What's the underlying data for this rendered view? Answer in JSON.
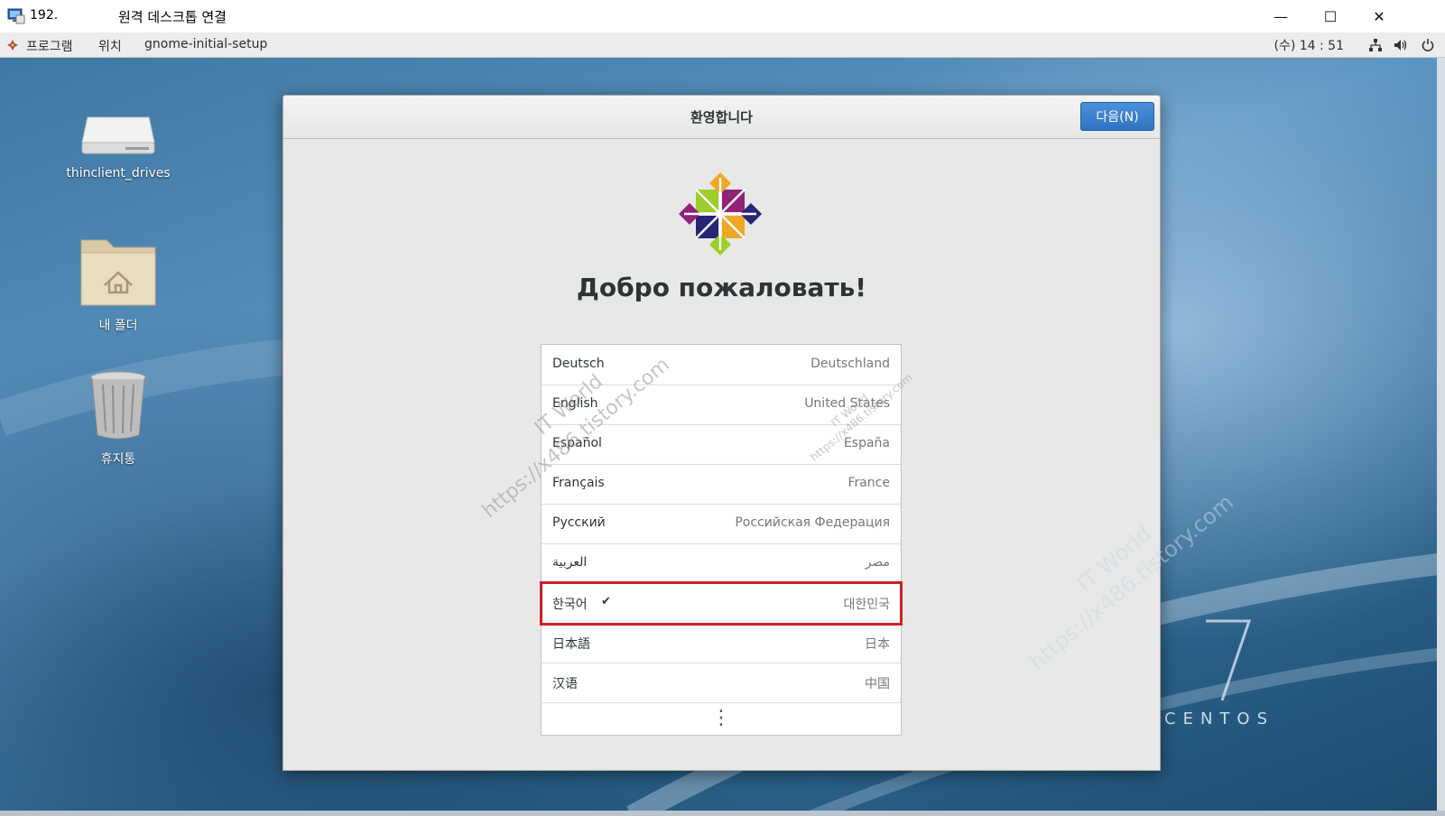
{
  "rdp_window": {
    "ip": "192.",
    "title": "원격 데스크톱 연결",
    "minimize": "—",
    "maximize": "☐",
    "close": "✕"
  },
  "panel": {
    "apps": "프로그램",
    "places": "위치",
    "app_name": "gnome-initial-setup",
    "clock": "(수) 14 : 51"
  },
  "desktop": {
    "icons": [
      {
        "label": "thinclient_drives"
      },
      {
        "label": "내 폴더"
      },
      {
        "label": "휴지통"
      }
    ],
    "brand_number": "7",
    "brand_text": "CENTOS"
  },
  "dialog": {
    "title": "환영합니다",
    "next_button": "다음(N)",
    "welcome": "Добро пожаловать!",
    "languages": [
      {
        "name": "Deutsch",
        "region": "Deutschland"
      },
      {
        "name": "English",
        "region": "United States"
      },
      {
        "name": "Español",
        "region": "España"
      },
      {
        "name": "Français",
        "region": "France"
      },
      {
        "name": "Русский",
        "region": "Российская Федерация"
      },
      {
        "name": "العربية",
        "region": "مصر"
      },
      {
        "name": "한국어",
        "region": "대한민국",
        "selected": true
      },
      {
        "name": "日本語",
        "region": "日本"
      },
      {
        "name": "汉语",
        "region": "中国"
      }
    ],
    "check_mark": "✔",
    "more": "⋮"
  },
  "watermarks": {
    "name": "IT World",
    "url": "https://x486.tistory.com"
  },
  "colors": {
    "accent": "#3584e4",
    "selection_outline": "#d01f26"
  }
}
